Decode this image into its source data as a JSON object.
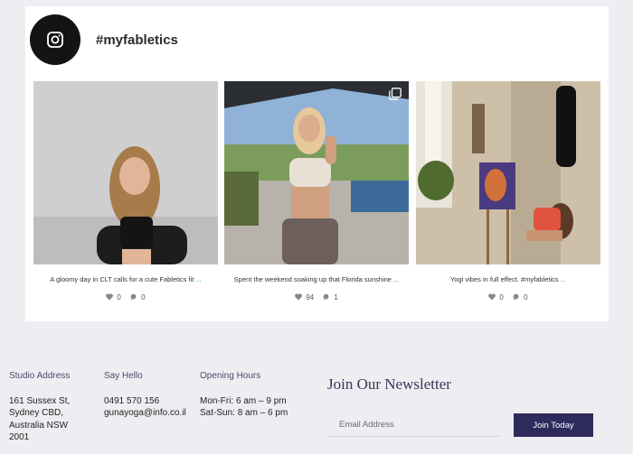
{
  "instagram": {
    "handle": "#myfabletics",
    "posts": [
      {
        "caption": "A gloomy day in CLT calls for a cute Fabletics fit",
        "more": "...",
        "likes": "0",
        "comments": "0"
      },
      {
        "caption": "Spent the weekend soaking up that Florida sunshine",
        "more": "...",
        "likes": "94",
        "comments": "1"
      },
      {
        "caption": "Yogi vibes in full effect. #myfabletics",
        "more": "...",
        "likes": "0",
        "comments": "0"
      }
    ]
  },
  "footer": {
    "studio_address": {
      "heading": "Studio Address",
      "lines": [
        "161 Sussex St,",
        "Sydney CBD,",
        "Australia NSW",
        "2001"
      ]
    },
    "say_hello": {
      "heading": "Say Hello",
      "lines": [
        "0491 570 156",
        "gunayoga@info.co.il"
      ]
    },
    "opening_hours": {
      "heading": "Opening Hours",
      "lines": [
        "Mon-Fri: 6 am – 9 pm",
        "Sat-Sun: 8 am – 6 pm"
      ]
    },
    "newsletter": {
      "title": "Join Our Newsletter",
      "email_placeholder": "Email Address",
      "button_label": "Join Today"
    }
  },
  "colors": {
    "accent": "#2f2a5c",
    "background": "#efedf1",
    "link": "#1c8a7a"
  }
}
